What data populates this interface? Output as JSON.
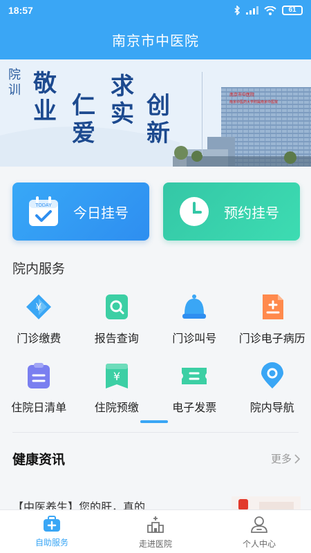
{
  "status_bar": {
    "time": "18:57",
    "battery": "61"
  },
  "header": {
    "title": "南京市中医院"
  },
  "banner": {
    "prefix": "院训",
    "motto": [
      "敬",
      "业",
      "仁",
      "爱",
      "求",
      "实",
      "创",
      "新"
    ],
    "building_sign_1": "南京市中医院",
    "building_sign_2": "南京中医药大学附属南京中医院"
  },
  "quick_actions": {
    "today": {
      "label": "今日挂号",
      "calendar_text": "TODAY",
      "color": "#2e8ef0"
    },
    "appoint": {
      "label": "预约挂号",
      "color": "#34c7a6"
    }
  },
  "services": {
    "title": "院内服务",
    "items": [
      {
        "label": "门诊缴费",
        "icon": "payment-diamond-icon",
        "color": "#3aa6f5"
      },
      {
        "label": "报告查询",
        "icon": "report-search-icon",
        "color": "#3ccfa4"
      },
      {
        "label": "门诊叫号",
        "icon": "bell-icon",
        "color": "#3aa6f5"
      },
      {
        "label": "门诊电子病历",
        "icon": "medical-record-icon",
        "color": "#ff8a4d"
      },
      {
        "label": "住院日清单",
        "icon": "clipboard-list-icon",
        "color": "#7a7ff0"
      },
      {
        "label": "住院预缴",
        "icon": "prepay-card-icon",
        "color": "#3ccfa4"
      },
      {
        "label": "电子发票",
        "icon": "invoice-ticket-icon",
        "color": "#3ccfa4"
      },
      {
        "label": "院内导航",
        "icon": "location-pin-icon",
        "color": "#3aa6f5"
      }
    ]
  },
  "health": {
    "title": "健康资讯",
    "more": "更多",
    "news": [
      {
        "title": "【中医养生】您的肝，真的..."
      }
    ]
  },
  "bottom_nav": {
    "items": [
      {
        "label": "自助服务",
        "icon": "self-service-icon",
        "active": true
      },
      {
        "label": "走进医院",
        "icon": "hospital-icon",
        "active": false
      },
      {
        "label": "个人中心",
        "icon": "user-icon",
        "active": false
      }
    ]
  },
  "colors": {
    "primary": "#3aa6f5",
    "green": "#34c7a6"
  }
}
